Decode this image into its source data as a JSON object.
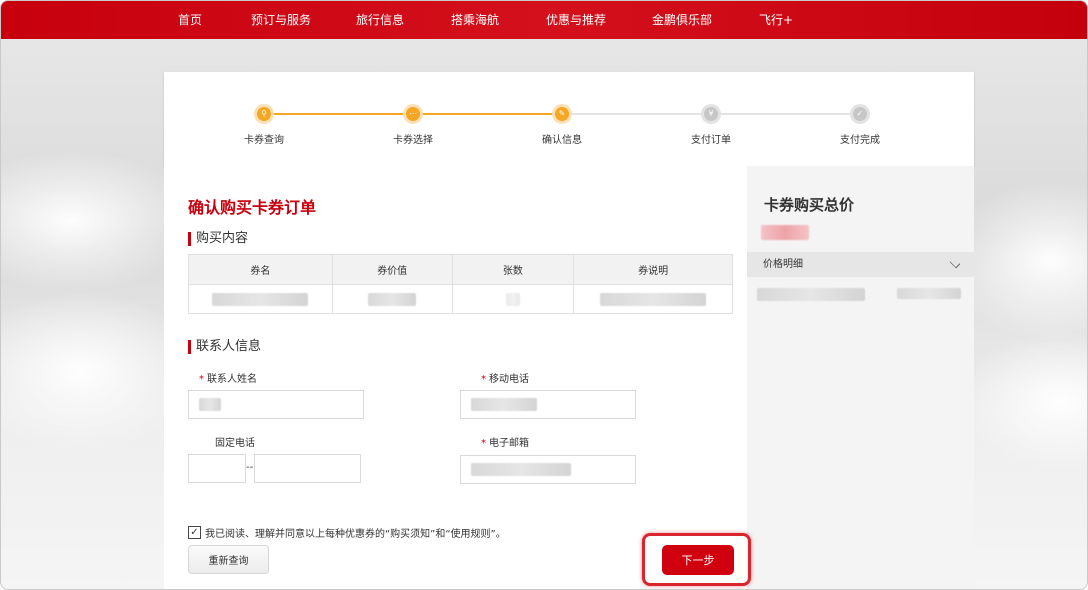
{
  "nav": {
    "items": [
      "首页",
      "预订与服务",
      "旅行信息",
      "搭乘海航",
      "优惠与推荐",
      "金鹏俱乐部",
      "飞行+"
    ]
  },
  "progress": {
    "steps": [
      {
        "label": "卡券查询",
        "state": "active",
        "icon": "search-icon"
      },
      {
        "label": "卡券选择",
        "state": "active",
        "icon": "ellipsis-icon"
      },
      {
        "label": "确认信息",
        "state": "active",
        "icon": "edit-icon"
      },
      {
        "label": "支付订单",
        "state": "pending",
        "icon": "currency-icon"
      },
      {
        "label": "支付完成",
        "state": "pending",
        "icon": "check-icon"
      }
    ],
    "active_color": "#f5a623",
    "pending_color": "#c7c7c7"
  },
  "main": {
    "title": "确认购买卡券订单",
    "purchase_section": "购买内容",
    "table_headers": [
      "券名",
      "券价值",
      "张数",
      "券说明"
    ],
    "contact_section": "联系人信息",
    "fields": {
      "name_label": "联系人姓名",
      "mobile_label": "移动电话",
      "phone_label": "固定电话",
      "phone_sep": "--",
      "email_label": "电子邮箱",
      "required_mark": "*"
    },
    "agree_text": "我已阅读、理解并同意以上每种优惠券的“购买须知”和“使用规则”。",
    "reset_button": "重新查询",
    "next_button": "下一步"
  },
  "side": {
    "title": "卡券购买总价",
    "detail_label": "价格明细"
  },
  "colors": {
    "brand_red": "#c8000e",
    "highlight": "#d9262e"
  }
}
